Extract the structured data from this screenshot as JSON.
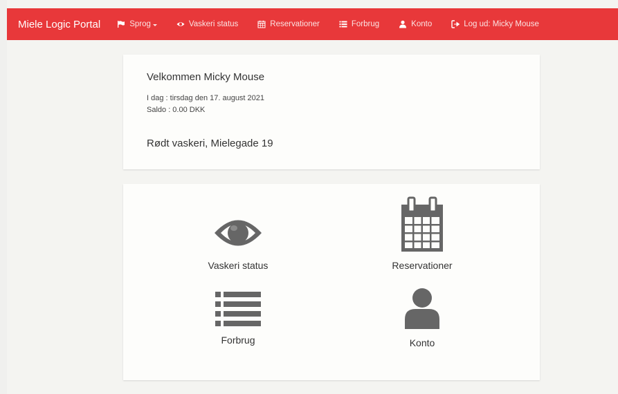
{
  "navbar": {
    "brand": "Miele Logic Portal",
    "items": [
      {
        "label": "Sprog",
        "icon": "flag-icon",
        "dropdown": true
      },
      {
        "label": "Vaskeri status",
        "icon": "eye-icon"
      },
      {
        "label": "Reservationer",
        "icon": "calendar-icon"
      },
      {
        "label": "Forbrug",
        "icon": "list-icon"
      },
      {
        "label": "Konto",
        "icon": "user-icon"
      },
      {
        "label": "Log ud: Micky Mouse",
        "icon": "logout-icon"
      }
    ],
    "color": "#e8383a"
  },
  "welcome": {
    "title": "Velkommen Micky Mouse",
    "date": "I dag : tirsdag den 17. august 2021",
    "balance": "Saldo : 0.00 DKK",
    "laundry": "Rødt vaskeri, Mielegade 19"
  },
  "menu": {
    "tiles": [
      {
        "label": "Vaskeri status",
        "icon": "eye-icon"
      },
      {
        "label": "Reservationer",
        "icon": "calendar-icon"
      },
      {
        "label": "Forbrug",
        "icon": "list-icon"
      },
      {
        "label": "Konto",
        "icon": "user-icon"
      }
    ],
    "icon_color": "#666666"
  }
}
